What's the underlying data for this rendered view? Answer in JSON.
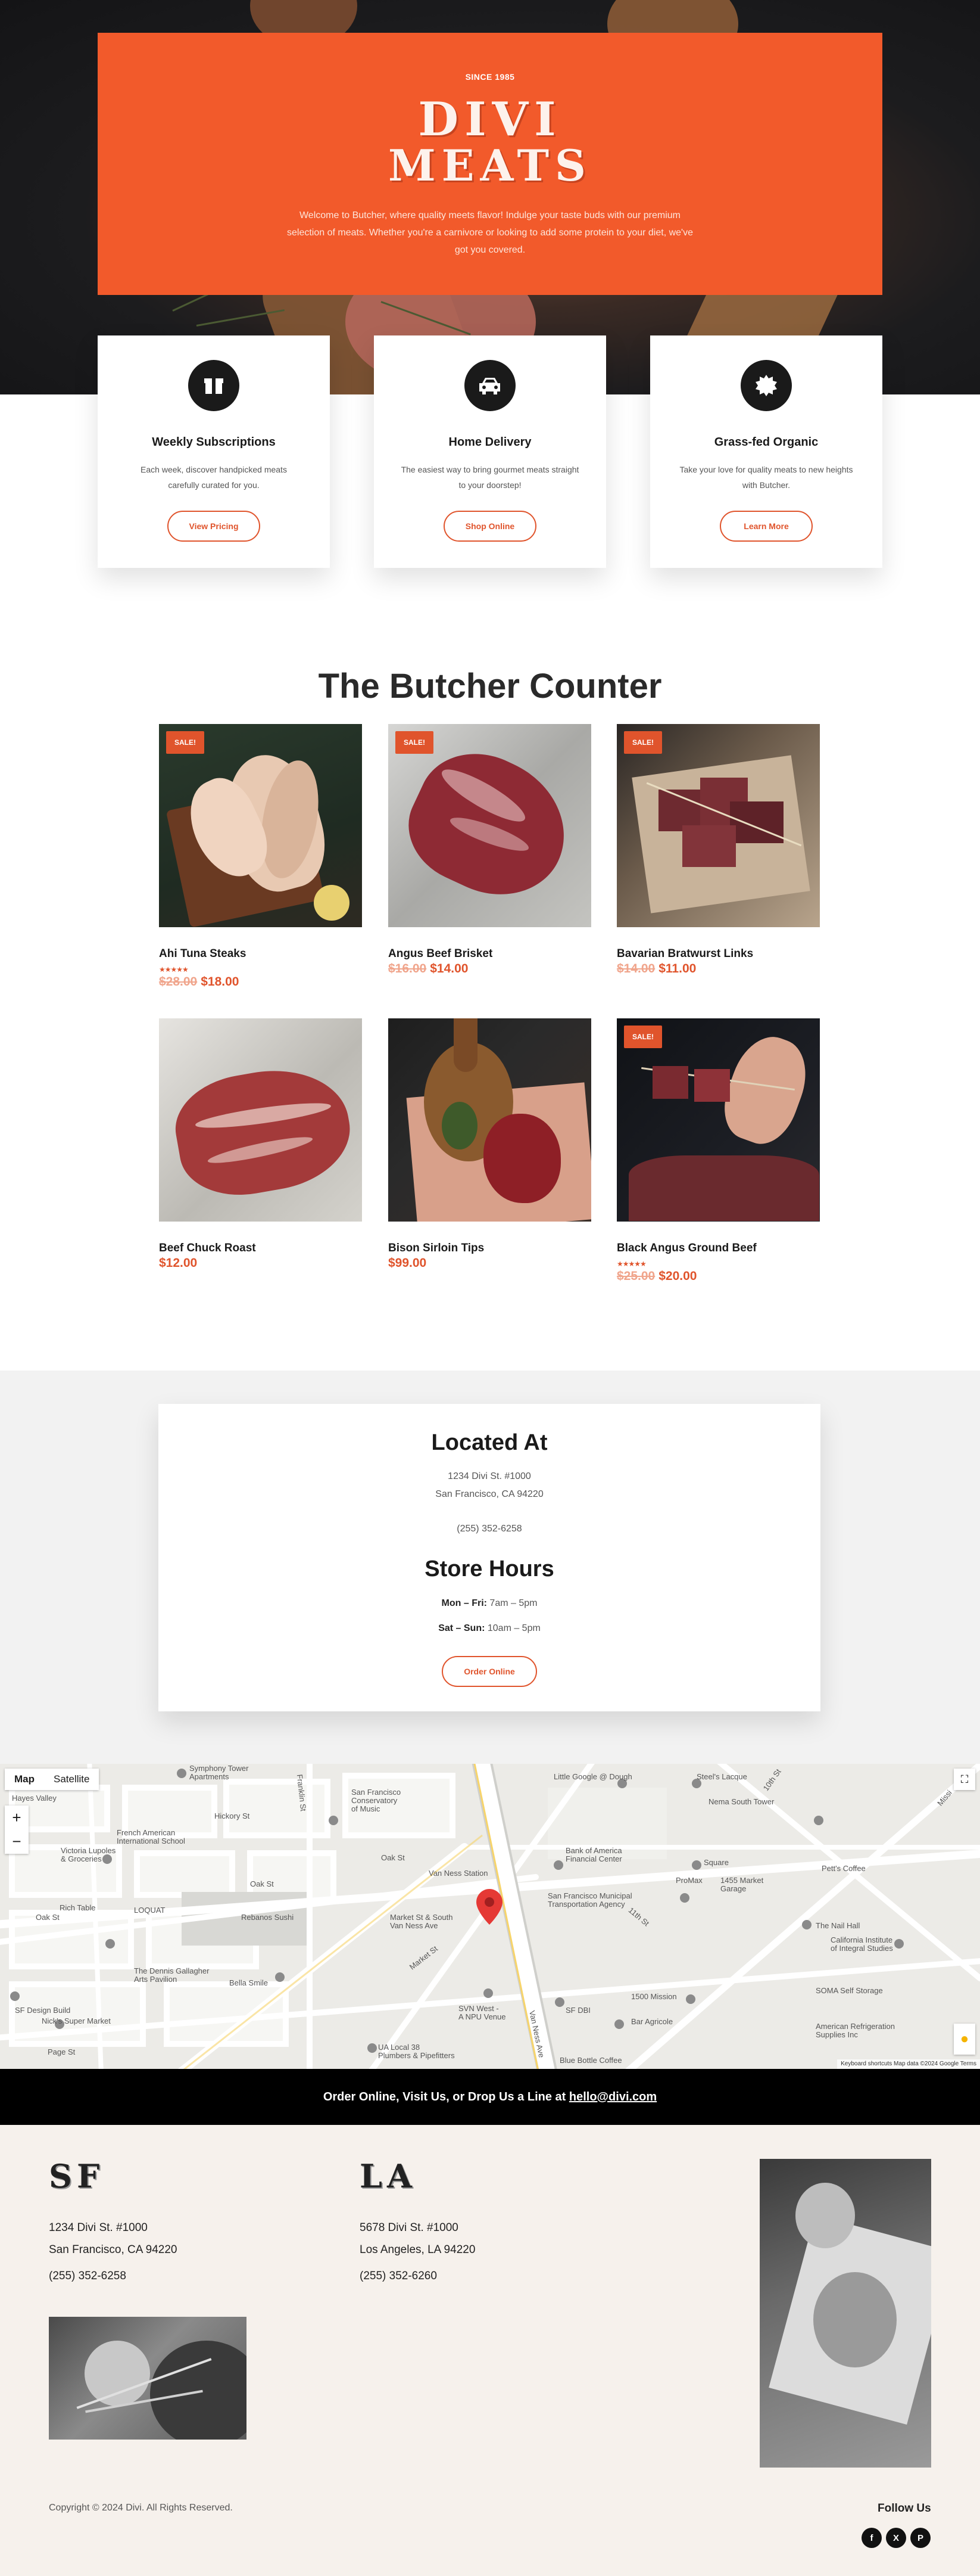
{
  "hero": {
    "since": "SINCE 1985",
    "logo_line1": "DIVI",
    "logo_line2": "MEATS",
    "intro": "Welcome to Butcher, where quality meets flavor! Indulge your taste buds with our premium selection of meats. Whether you're a carnivore or looking to add some protein to your diet, we've got you covered."
  },
  "features": [
    {
      "icon": "box-icon",
      "title": "Weekly Subscriptions",
      "text": "Each week, discover handpicked meats carefully curated for you.",
      "button": "View Pricing"
    },
    {
      "icon": "car-icon",
      "title": "Home Delivery",
      "text": "The easiest way to bring gourmet meats straight to your doorstep!",
      "button": "Shop Online"
    },
    {
      "icon": "badge-icon",
      "title": "Grass-fed Organic",
      "text": "Take your love for quality meats to new heights with Butcher.",
      "button": "Learn More"
    }
  ],
  "shop": {
    "title": "The Butcher Counter",
    "sale_label": "SALE!",
    "stars": "★★★★★",
    "products": [
      {
        "name": "Ahi Tuna Steaks",
        "sale": true,
        "rated": true,
        "old_price": "$28.00",
        "price": "$18.00"
      },
      {
        "name": "Angus Beef Brisket",
        "sale": true,
        "rated": false,
        "old_price": "$16.00",
        "price": "$14.00"
      },
      {
        "name": "Bavarian Bratwurst Links",
        "sale": true,
        "rated": false,
        "old_price": "$14.00",
        "price": "$11.00"
      },
      {
        "name": "Beef Chuck Roast",
        "sale": false,
        "rated": false,
        "old_price": "",
        "price": "$12.00"
      },
      {
        "name": "Bison Sirloin Tips",
        "sale": false,
        "rated": false,
        "old_price": "",
        "price": "$99.00"
      },
      {
        "name": "Black Angus Ground Beef",
        "sale": true,
        "rated": true,
        "old_price": "$25.00",
        "price": "$20.00"
      }
    ]
  },
  "location": {
    "title": "Located At",
    "address1": "1234 Divi St. #1000",
    "address2": "San Francisco, CA 94220",
    "phone": "(255) 352-6258",
    "hours_title": "Store Hours",
    "hours1_day": "Mon – Fri:",
    "hours1_time": " 7am – 5pm",
    "hours2_day": "Sat – Sun:",
    "hours2_time": " 10am – 5pm",
    "button": "Order Online"
  },
  "map": {
    "type_map": "Map",
    "type_satellite": "Satellite",
    "zoom_in": "+",
    "zoom_out": "−",
    "footer": "Keyboard shortcuts   Map data ©2024 Google   Terms",
    "labels": [
      "Symphony Tower Apartments",
      "Hayes Valley",
      "San Francisco Conservatory of Music",
      "Little Google @ Dough",
      "Steel's Lacque",
      "Nema South Tower",
      "Hickory St",
      "French American International School",
      "Oak St",
      "Victoria Lupoles & Groceries",
      "Oak St",
      "Van Ness Station",
      "Bank of America Financial Center",
      "Square",
      "ProMax",
      "1455 Market Garage",
      "Pett's Coffee",
      "Oak St",
      "Rich Table",
      "LOQUAT",
      "Rebanos Sushi",
      "Market St & South Van Ness Ave",
      "San Francisco Municipal Transportation Agency",
      "The Nail Hall",
      "California Institute of Integral Studies",
      "The Dennis Gallagher Arts Pavilion",
      "SF Design Build",
      "Nick's Super Market",
      "Bella Smile",
      "SVN West - A NPU Venue",
      "SF DBI",
      "Bar Agricole",
      "1500 Mission",
      "SOMA Self Storage",
      "American Refrigeration Supplies Inc",
      "UA Local 38 Plumbers & Pipefitters",
      "Blue Bottle Coffee",
      "Page St",
      "Market St",
      "Van Ness Ave",
      "Franklin St",
      "11th St",
      "10th St",
      "Mission St"
    ]
  },
  "bar": {
    "text": "Order Online, Visit Us, or Drop Us a Line at ",
    "email": "hello@divi.com"
  },
  "footer": {
    "sf": {
      "title": "SF",
      "addr1": "1234 Divi St. #1000",
      "addr2": "San Francisco, CA 94220",
      "phone": "(255) 352-6258"
    },
    "la": {
      "title": "LA",
      "addr1": "5678 Divi St. #1000",
      "addr2": "Los Angeles, LA 94220",
      "phone": "(255) 352-6260"
    },
    "copyright": "Copyright © 2024 Divi. All Rights Reserved.",
    "follow": "Follow Us",
    "social": [
      "facebook-icon",
      "x-icon",
      "pinterest-icon"
    ]
  },
  "colors": {
    "accent": "#f25a2b",
    "button": "#e0542c",
    "dark": "#1a1a1a",
    "footer_bg": "#f6f1ec"
  }
}
